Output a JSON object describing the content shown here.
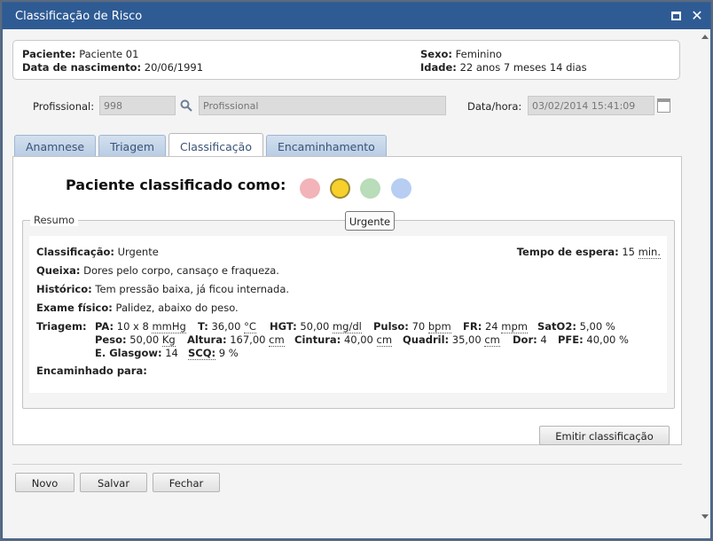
{
  "window": {
    "title": "Classificação de Risco"
  },
  "patient": {
    "paciente_label": "Paciente:",
    "paciente_value": "Paciente 01",
    "nascimento_label": "Data de nascimento:",
    "nascimento_value": "20/06/1991",
    "sexo_label": "Sexo:",
    "sexo_value": "Feminino",
    "idade_label": "Idade:",
    "idade_value": "22 anos 7 meses 14 dias"
  },
  "form": {
    "profissional_label": "Profissional:",
    "profissional_code": "998",
    "profissional_name_placeholder": "Profissional",
    "datahora_label": "Data/hora:",
    "datahora_value": "03/02/2014 15:41:09"
  },
  "tabs": [
    {
      "label": "Anamnese",
      "active": false
    },
    {
      "label": "Triagem",
      "active": false
    },
    {
      "label": "Classificação",
      "active": true
    },
    {
      "label": "Encaminhamento",
      "active": false
    }
  ],
  "classification": {
    "heading": "Paciente classificado como:",
    "colors": [
      {
        "name": "red",
        "fill": "#f2b4b8",
        "selected": false
      },
      {
        "name": "yellow",
        "fill": "#f7d02c",
        "selected": true
      },
      {
        "name": "green",
        "fill": "#b9dcb9",
        "selected": false
      },
      {
        "name": "blue",
        "fill": "#b7cdf2",
        "selected": false
      }
    ],
    "tooltip": "Urgente"
  },
  "resumo": {
    "legend": "Resumo",
    "classificacao_label": "Classificação:",
    "classificacao_value": "Urgente",
    "tempo_label": "Tempo de espera:",
    "tempo_value": "15",
    "tempo_unit": "min.",
    "queixa_label": "Queixa:",
    "queixa_value": "Dores pelo corpo, cansaço e fraqueza.",
    "historico_label": "Histórico:",
    "historico_value": "Tem pressão baixa, já ficou internada.",
    "exame_label": "Exame físico:",
    "exame_value": "Palidez, abaixo do peso.",
    "triagem_label": "Triagem:",
    "triagem_row1": [
      {
        "label": "PA:",
        "value": "10 x 8",
        "unit": "mmHg"
      },
      {
        "label": "T:",
        "value": "36,00",
        "unit": "°C"
      },
      {
        "label": "HGT:",
        "value": "50,00",
        "unit": "mg/dl"
      },
      {
        "label": "Pulso:",
        "value": "70",
        "unit": "bpm"
      },
      {
        "label": "FR:",
        "value": "24",
        "unit": "mpm"
      },
      {
        "label": "SatO2:",
        "value": "5,00",
        "unit": "%"
      }
    ],
    "triagem_row2": [
      {
        "label": "Peso:",
        "value": "50,00",
        "unit": "Kg"
      },
      {
        "label": "Altura:",
        "value": "167,00",
        "unit": "cm"
      },
      {
        "label": "Cintura:",
        "value": "40,00",
        "unit": "cm"
      },
      {
        "label": "Quadril:",
        "value": "35,00",
        "unit": "cm"
      },
      {
        "label": "Dor:",
        "value": "4",
        "unit": ""
      },
      {
        "label": "PFE:",
        "value": "40,00",
        "unit": "%"
      }
    ],
    "triagem_row3": [
      {
        "label": "E. Glasgow:",
        "value": "14",
        "unit": ""
      },
      {
        "label": "SCQ:",
        "value": "9",
        "unit": "%"
      }
    ],
    "encaminhado_label": "Encaminhado para:"
  },
  "buttons": {
    "emitir": "Emitir classificação",
    "novo": "Novo",
    "salvar": "Salvar",
    "fechar": "Fechar"
  },
  "colors": {
    "titlebar": "#2f5b94",
    "tab_text": "#3a5378"
  }
}
